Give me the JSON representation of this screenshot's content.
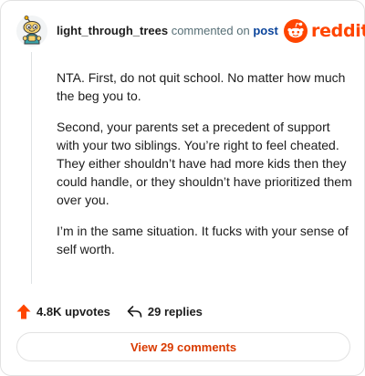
{
  "header": {
    "username": "light_through_trees",
    "action_text": "commented on",
    "post_link": "post"
  },
  "brand": {
    "name": "reddit",
    "color": "#ff4500"
  },
  "comment": {
    "paragraphs": [
      "NTA. First, do not quit school. No matter how much the beg you to.",
      "Second, your parents set a precedent of support with your two siblings. You’re right to feel cheated. They either shouldn’t have had more kids then they could handle, or they shouldn’t have prioritized them over you.",
      "I’m in the same situation. It fucks with your sense of self worth."
    ]
  },
  "stats": {
    "upvotes": "4.8K upvotes",
    "replies": "29 replies"
  },
  "footer": {
    "view_comments_label": "View 29 comments"
  },
  "icons": {
    "avatar": "snoo-avatar",
    "logo": "reddit-snoo-logo",
    "upvote": "upvote-arrow-icon",
    "reply": "reply-arrow-icon"
  }
}
